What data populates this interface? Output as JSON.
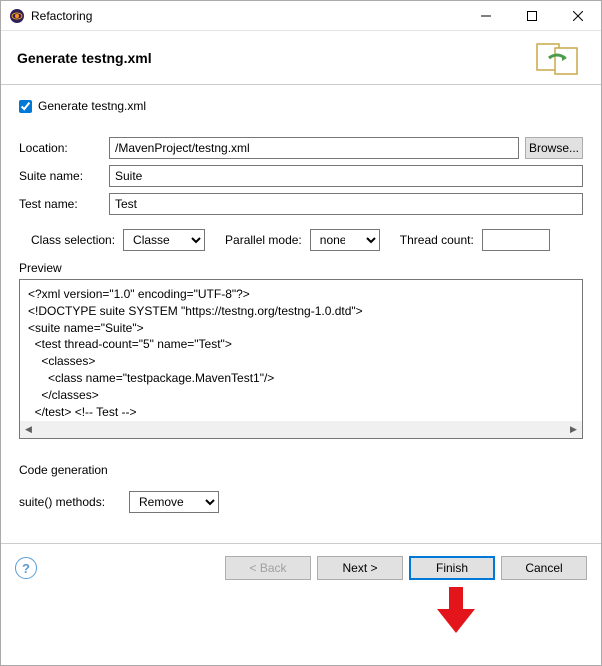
{
  "window": {
    "title": "Refactoring"
  },
  "banner": {
    "title": "Generate testng.xml"
  },
  "checkbox": {
    "label": "Generate testng.xml",
    "checked": true
  },
  "form": {
    "location_label": "Location:",
    "location_value": "/MavenProject/testng.xml",
    "browse_label": "Browse...",
    "suite_label": "Suite name:",
    "suite_value": "Suite",
    "test_label": "Test name:",
    "test_value": "Test"
  },
  "options": {
    "class_selection_label": "Class selection:",
    "class_selection_value": "Classes",
    "parallel_label": "Parallel mode:",
    "parallel_value": "none",
    "thread_count_label": "Thread count:",
    "thread_count_value": ""
  },
  "preview": {
    "label": "Preview",
    "text": "<?xml version=\"1.0\" encoding=\"UTF-8\"?>\n<!DOCTYPE suite SYSTEM \"https://testng.org/testng-1.0.dtd\">\n<suite name=\"Suite\">\n  <test thread-count=\"5\" name=\"Test\">\n    <classes>\n      <class name=\"testpackage.MavenTest1\"/>\n    </classes>\n  </test> <!-- Test -->\n</suite> <!-- Suite -->"
  },
  "codegen": {
    "section_label": "Code generation",
    "suite_methods_label": "suite() methods:",
    "suite_methods_value": "Remove"
  },
  "footer": {
    "back": "< Back",
    "next": "Next >",
    "finish": "Finish",
    "cancel": "Cancel"
  }
}
